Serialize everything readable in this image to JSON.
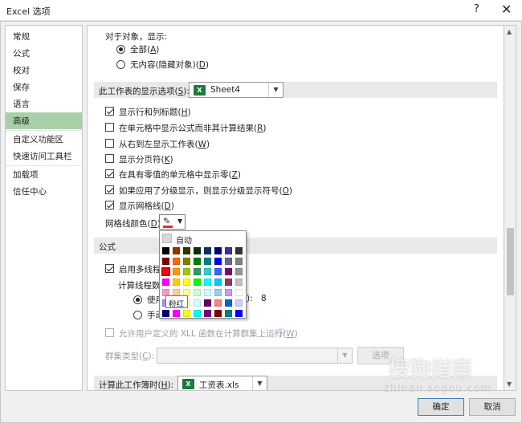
{
  "window": {
    "title": "Excel 选项",
    "help": "?",
    "close": "✕"
  },
  "sidebar": {
    "items": [
      {
        "label": "常规"
      },
      {
        "label": "公式"
      },
      {
        "label": "校对"
      },
      {
        "label": "保存"
      },
      {
        "label": "语言"
      },
      {
        "label": "高级",
        "active": true
      },
      {
        "label": "自定义功能区"
      },
      {
        "label": "快速访问工具栏"
      },
      {
        "label": "加载项"
      },
      {
        "label": "信任中心"
      }
    ]
  },
  "objects": {
    "heading": "对于对象，显示:",
    "options": [
      {
        "label": "全部(",
        "key": "A",
        "suffix": ")",
        "selected": true
      },
      {
        "label": "无内容(隐藏对象)(",
        "key": "D",
        "suffix": ")",
        "selected": false
      }
    ]
  },
  "sheet_section": {
    "label": "此工作表的显示选项(",
    "key": "S",
    "suffix": "):",
    "sheet_value": "Sheet4",
    "checkboxes": [
      {
        "label": "显示行和列标题(",
        "key": "H",
        "suffix": ")",
        "checked": true
      },
      {
        "label": "在单元格中显示公式而非其计算结果(",
        "key": "R",
        "suffix": ")",
        "checked": false
      },
      {
        "label": "从右到左显示工作表(",
        "key": "W",
        "suffix": ")",
        "checked": false
      },
      {
        "label": "显示分页符(",
        "key": "K",
        "suffix": ")",
        "checked": false
      },
      {
        "label": "在具有零值的单元格中显示零(",
        "key": "Z",
        "suffix": ")",
        "checked": true
      },
      {
        "label": "如果应用了分级显示，则显示分级显示符号(",
        "key": "O",
        "suffix": ")",
        "checked": true
      },
      {
        "label": "显示网格线(",
        "key": "D",
        "suffix": ")",
        "checked": true
      }
    ],
    "gridline_color_label": "网格线颜色(",
    "gridline_color_key": "D",
    "gridline_color_suffix": ")",
    "gridline_color": "#e03030"
  },
  "formulas_section": {
    "label": "公式",
    "multithread_label": "启用多线程计",
    "threads_label": "计算线程数",
    "use_label": "使用",
    "use_suffix": "):",
    "use_value": "8",
    "manual_label": "手动",
    "xll_label": "允许用户定义的 XLL 函数在计算群集上运行(",
    "xll_key": "W",
    "xll_suffix": ")",
    "cluster_label": "群集类型(",
    "cluster_key": "C",
    "cluster_suffix": "):",
    "options_button": "选项"
  },
  "workbook_section": {
    "label": "计算此工作簿时(",
    "key": "H",
    "suffix": "):",
    "workbook_value": "工资表.xls"
  },
  "color_popup": {
    "auto_label": "自动",
    "tooltip": "粉红",
    "rows": [
      [
        "#000000",
        "#993300",
        "#333300",
        "#003300",
        "#003366",
        "#000080",
        "#333399",
        "#333333"
      ],
      [
        "#800000",
        "#FF6600",
        "#808000",
        "#008000",
        "#008080",
        "#0000FF",
        "#666699",
        "#808080"
      ],
      [
        "#FF0000",
        "#FF9900",
        "#99CC00",
        "#339966",
        "#33CCCC",
        "#3366FF",
        "#800080",
        "#969696"
      ],
      [
        "#FF00FF",
        "#FFCC00",
        "#FFFF00",
        "#00FF00",
        "#00FFFF",
        "#00CCFF",
        "#993366",
        "#C0C0C0"
      ],
      [
        "#FF99CC",
        "#FFCC99",
        "#FFFF99",
        "#CCFFCC",
        "#CCFFFF",
        "#99CCFF",
        "#CC99FF",
        "#FFFFFF"
      ],
      [
        "#9999FF",
        "#993366",
        "#FFFFCC",
        "#CCFFFF",
        "#660066",
        "#FF8080",
        "#0066CC",
        "#CCCCFF"
      ],
      [
        "#000080",
        "#FF00FF",
        "#FFFF00",
        "#00FFFF",
        "#800080",
        "#800000",
        "#008080",
        "#0000FF"
      ]
    ],
    "selected_row": 2,
    "selected_col": 0
  },
  "footer": {
    "ok": "确定",
    "cancel": "取消"
  },
  "watermark": {
    "text": "搜狗指南",
    "url": "zhinan.sogou.com"
  }
}
